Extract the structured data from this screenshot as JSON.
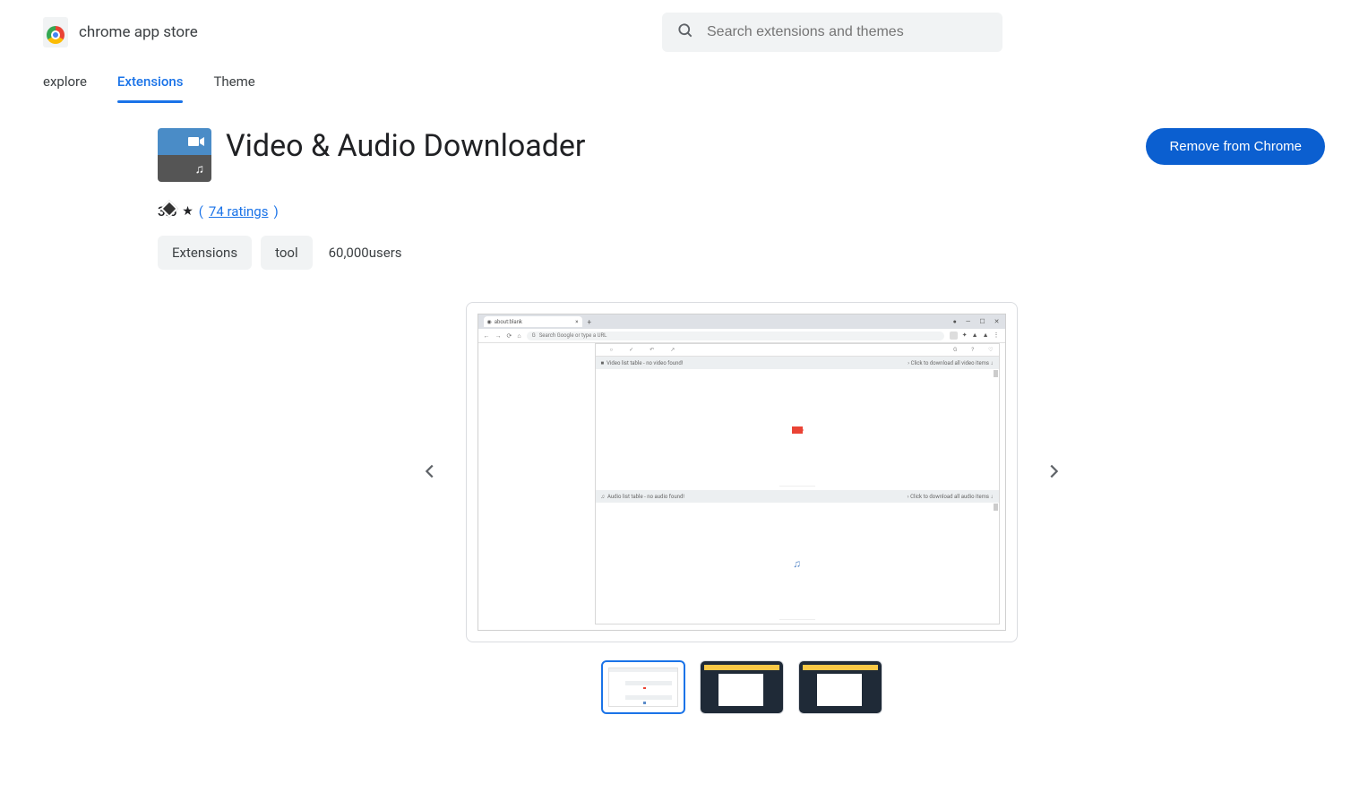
{
  "header": {
    "store_title": "chrome app store",
    "search_placeholder": "Search extensions and themes"
  },
  "tabs": {
    "explore": "explore",
    "extensions": "Extensions",
    "theme": "Theme"
  },
  "extension": {
    "title": "Video & Audio Downloader",
    "remove_label": "Remove from Chrome",
    "rating": "3.6",
    "ratings_count_text": "74 ratings",
    "tag_extensions": "Extensions",
    "tag_tool": "tool",
    "users_text": "60,000users"
  },
  "mock": {
    "tab_label": "about:blank",
    "url_placeholder": "Search Google or type a URL",
    "video_header_left": "Video list table - no video found!",
    "video_header_right": "Click to download all video items",
    "audio_header_left": "Audio list table - no audio found!",
    "audio_header_right": "Click to download all audio items"
  }
}
